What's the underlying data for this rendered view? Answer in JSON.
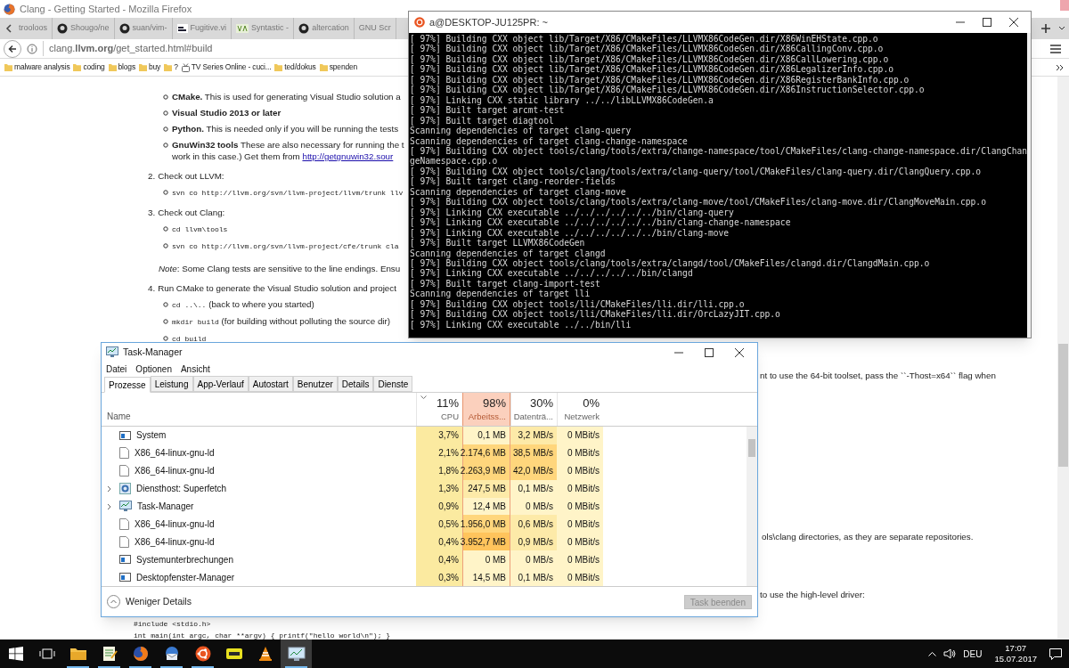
{
  "browser": {
    "title": "Clang - Getting Started - Mozilla Firefox",
    "tabs": [
      {
        "label": "trooloos",
        "kind": "plain",
        "selected": false
      },
      {
        "label": "Shougo/ne",
        "kind": "github",
        "selected": false
      },
      {
        "label": "suan/vim-",
        "kind": "github",
        "selected": false
      },
      {
        "label": "Fugitive.vi",
        "kind": "fugitive",
        "selected": false
      },
      {
        "label": "Syntastic -",
        "kind": "va",
        "selected": false
      },
      {
        "label": "altercation",
        "kind": "github",
        "selected": false
      },
      {
        "label": "GNU Scr",
        "kind": "plain",
        "selected": false
      }
    ],
    "url": "clang.**llvm.org**/get_started.html#build",
    "bookmarks": [
      {
        "label": "malware analysis",
        "kind": "folder"
      },
      {
        "label": "coding",
        "kind": "folder"
      },
      {
        "label": "blogs",
        "kind": "folder"
      },
      {
        "label": "buy",
        "kind": "folder"
      },
      {
        "label": "?",
        "kind": "folder"
      },
      {
        "label": "TV Series Online - cuci...",
        "kind": "site"
      },
      {
        "label": "ted/dokus",
        "kind": "folder"
      },
      {
        "label": "spenden",
        "kind": "folder"
      }
    ]
  },
  "page": {
    "blocks": [
      {
        "kind": "bullet",
        "parts": [
          {
            "kind": "text",
            "text": "**CMake.** This is used for generating Visual Studio solution a"
          }
        ]
      },
      {
        "kind": "bullet",
        "parts": [
          {
            "kind": "text",
            "text": "**Visual Studio 2013 or later**"
          }
        ]
      },
      {
        "kind": "bullet",
        "parts": [
          {
            "kind": "text",
            "text": "**Python.** This is needed only if you will be running the tests"
          }
        ]
      },
      {
        "kind": "bullet",
        "parts": [
          {
            "kind": "text",
            "text": "**GnuWin32 tools** These are also necessary for running the t"
          }
        ]
      },
      {
        "kind": "continuation",
        "parts": [
          {
            "kind": "text",
            "text": "work in this case.) Get them from "
          },
          {
            "kind": "link",
            "text": "http://getgnuwin32.sour"
          }
        ]
      },
      {
        "kind": "numbered",
        "number": "2.",
        "parts": [
          {
            "kind": "text",
            "text": "Check out LLVM:"
          }
        ]
      },
      {
        "kind": "bullet",
        "parts": [
          {
            "kind": "code",
            "text": "svn co http://llvm.org/svn/llvm-project/llvm/trunk llv"
          }
        ]
      },
      {
        "kind": "numbered",
        "number": "3.",
        "parts": [
          {
            "kind": "text",
            "text": "Check out Clang:"
          }
        ]
      },
      {
        "kind": "bullet",
        "parts": [
          {
            "kind": "code",
            "text": "cd llvm\\tools"
          }
        ]
      },
      {
        "kind": "bullet",
        "parts": [
          {
            "kind": "code",
            "text": "svn co http://llvm.org/svn/llvm-project/cfe/trunk cla"
          }
        ]
      },
      {
        "kind": "note",
        "parts": [
          {
            "kind": "text",
            "text": "*Note*: Some Clang tests are sensitive to the line endings. Ensu"
          }
        ]
      },
      {
        "kind": "numbered",
        "number": "4.",
        "parts": [
          {
            "kind": "text",
            "text": "Run CMake to generate the Visual Studio solution and project"
          }
        ]
      },
      {
        "kind": "bullet",
        "parts": [
          {
            "kind": "code",
            "text": "cd ..\\.."
          },
          {
            "kind": "text",
            "text": " (back to where you started)"
          }
        ]
      },
      {
        "kind": "bullet",
        "parts": [
          {
            "kind": "code",
            "text": "mkdir build"
          },
          {
            "kind": "text",
            "text": " (for building without polluting the source dir)"
          }
        ]
      },
      {
        "kind": "bullet",
        "parts": [
          {
            "kind": "code",
            "text": "cd build"
          }
        ]
      }
    ],
    "fragments": [
      "nt to use the 64-bit toolset, pass the ``-Thost=x64`` flag when",
      "ols\\clang directories, as they are separate repositories.",
      "to use the high-level driver:"
    ],
    "code": [
      "#include <stdio.h>",
      "int main(int argc, char **argv) { printf(\"hello world\\n\"); }"
    ]
  },
  "terminal": {
    "title": "a@DESKTOP-JU125PR: ~",
    "lines": [
      "[ 97%] Building CXX object lib/Target/X86/CMakeFiles/LLVMX86CodeGen.dir/X86WinEHState.cpp.o",
      "[ 97%] Building CXX object lib/Target/X86/CMakeFiles/LLVMX86CodeGen.dir/X86CallingConv.cpp.o",
      "[ 97%] Building CXX object lib/Target/X86/CMakeFiles/LLVMX86CodeGen.dir/X86CallLowering.cpp.o",
      "[ 97%] Building CXX object lib/Target/X86/CMakeFiles/LLVMX86CodeGen.dir/X86LegalizerInfo.cpp.o",
      "[ 97%] Building CXX object lib/Target/X86/CMakeFiles/LLVMX86CodeGen.dir/X86RegisterBankInfo.cpp.o",
      "[ 97%] Building CXX object lib/Target/X86/CMakeFiles/LLVMX86CodeGen.dir/X86InstructionSelector.cpp.o",
      "[ 97%] Linking CXX static library ../../libLLVMX86CodeGen.a",
      "[ 97%] Built target arcmt-test",
      "[ 97%] Built target diagtool",
      "Scanning dependencies of target clang-query",
      "Scanning dependencies of target clang-change-namespace",
      "[ 97%] Building CXX object tools/clang/tools/extra/change-namespace/tool/CMakeFiles/clang-change-namespace.dir/ClangChan",
      "geNamespace.cpp.o",
      "[ 97%] Building CXX object tools/clang/tools/extra/clang-query/tool/CMakeFiles/clang-query.dir/ClangQuery.cpp.o",
      "[ 97%] Built target clang-reorder-fields",
      "Scanning dependencies of target clang-move",
      "[ 97%] Building CXX object tools/clang/tools/extra/clang-move/tool/CMakeFiles/clang-move.dir/ClangMoveMain.cpp.o",
      "[ 97%] Linking CXX executable ../../../../../../bin/clang-query",
      "[ 97%] Linking CXX executable ../../../../../../bin/clang-change-namespace",
      "[ 97%] Linking CXX executable ../../../../../../bin/clang-move",
      "[ 97%] Built target LLVMX86CodeGen",
      "Scanning dependencies of target clangd",
      "[ 97%] Building CXX object tools/clang/tools/extra/clangd/tool/CMakeFiles/clangd.dir/ClangdMain.cpp.o",
      "[ 97%] Linking CXX executable ../../../../../bin/clangd",
      "[ 97%] Built target clang-import-test",
      "Scanning dependencies of target lli",
      "[ 97%] Building CXX object tools/lli/CMakeFiles/lli.dir/lli.cpp.o",
      "[ 97%] Building CXX object tools/lli/CMakeFiles/lli.dir/OrcLazyJIT.cpp.o",
      "[ 97%] Linking CXX executable ../../bin/lli"
    ]
  },
  "task_manager": {
    "title": "Task-Manager",
    "menu": [
      "Datei",
      "Optionen",
      "Ansicht"
    ],
    "tabs": [
      {
        "label": "Prozesse",
        "selected": true
      },
      {
        "label": "Leistung",
        "selected": false
      },
      {
        "label": "App-Verlauf",
        "selected": false
      },
      {
        "label": "Autostart",
        "selected": false
      },
      {
        "label": "Benutzer",
        "selected": false
      },
      {
        "label": "Details",
        "selected": false
      },
      {
        "label": "Dienste",
        "selected": false
      }
    ],
    "name_header": "Name",
    "columns": [
      {
        "percent": "11%",
        "label": "CPU",
        "sorted": true,
        "alert": false
      },
      {
        "percent": "98%",
        "label": "Arbeitss...",
        "sorted": false,
        "alert": true
      },
      {
        "percent": "30%",
        "label": "Datenträ...",
        "sorted": false,
        "alert": false
      },
      {
        "percent": "0%",
        "label": "Netzwerk",
        "sorted": false,
        "alert": false
      }
    ],
    "rows": [
      {
        "name": "System",
        "kind": "system",
        "expandable": false,
        "cells": [
          {
            "text": "3,7%",
            "color": "#fbeaa0"
          },
          {
            "text": "0,1 MB",
            "color": "#fff4c8"
          },
          {
            "text": "3,2 MB/s",
            "color": "#fdeaa8"
          },
          {
            "text": "0 MBit/s",
            "color": "#fff4c8"
          }
        ]
      },
      {
        "name": "X86_64-linux-gnu-ld",
        "kind": "file",
        "expandable": false,
        "cells": [
          {
            "text": "2,1%",
            "color": "#fbeaa0"
          },
          {
            "text": "2.174,6 MB",
            "color": "#ffd67c"
          },
          {
            "text": "38,5 MB/s",
            "color": "#ffd67c"
          },
          {
            "text": "0 MBit/s",
            "color": "#fff4c8"
          }
        ]
      },
      {
        "name": "X86_64-linux-gnu-ld",
        "kind": "file",
        "expandable": false,
        "cells": [
          {
            "text": "1,8%",
            "color": "#fbeaa0"
          },
          {
            "text": "2.263,9 MB",
            "color": "#ffd67c"
          },
          {
            "text": "42,0 MB/s",
            "color": "#ffd67c"
          },
          {
            "text": "0 MBit/s",
            "color": "#fff4c8"
          }
        ]
      },
      {
        "name": "Diensthost: Superfetch",
        "kind": "service",
        "expandable": true,
        "cells": [
          {
            "text": "1,3%",
            "color": "#fbeaa0"
          },
          {
            "text": "247,5 MB",
            "color": "#fdeaa8"
          },
          {
            "text": "0,1 MB/s",
            "color": "#fff4c8"
          },
          {
            "text": "0 MBit/s",
            "color": "#fff4c8"
          }
        ]
      },
      {
        "name": "Task-Manager",
        "kind": "taskmgr",
        "expandable": true,
        "cells": [
          {
            "text": "0,9%",
            "color": "#fbeaa0"
          },
          {
            "text": "12,4 MB",
            "color": "#fff4c8"
          },
          {
            "text": "0 MB/s",
            "color": "#fff4c8"
          },
          {
            "text": "0 MBit/s",
            "color": "#fff4c8"
          }
        ]
      },
      {
        "name": "X86_64-linux-gnu-ld",
        "kind": "file",
        "expandable": false,
        "cells": [
          {
            "text": "0,5%",
            "color": "#fbeaa0"
          },
          {
            "text": "1.956,0 MB",
            "color": "#ffd67c"
          },
          {
            "text": "0,6 MB/s",
            "color": "#fdeaa8"
          },
          {
            "text": "0 MBit/s",
            "color": "#fff4c8"
          }
        ]
      },
      {
        "name": "X86_64-linux-gnu-ld",
        "kind": "file",
        "expandable": false,
        "cells": [
          {
            "text": "0,4%",
            "color": "#fbeaa0"
          },
          {
            "text": "3.952,7 MB",
            "color": "#ffc45c"
          },
          {
            "text": "0,9 MB/s",
            "color": "#fdeaa8"
          },
          {
            "text": "0 MBit/s",
            "color": "#fff4c8"
          }
        ]
      },
      {
        "name": "Systemunterbrechungen",
        "kind": "system",
        "expandable": false,
        "cells": [
          {
            "text": "0,4%",
            "color": "#fbeaa0"
          },
          {
            "text": "0 MB",
            "color": "#fff4c8"
          },
          {
            "text": "0 MB/s",
            "color": "#fff4c8"
          },
          {
            "text": "0 MBit/s",
            "color": "#fff4c8"
          }
        ]
      },
      {
        "name": "Desktopfenster-Manager",
        "kind": "system",
        "expandable": false,
        "cells": [
          {
            "text": "0,3%",
            "color": "#fbeaa0"
          },
          {
            "text": "14,5 MB",
            "color": "#fff4c8"
          },
          {
            "text": "0,1 MB/s",
            "color": "#fff4c8"
          },
          {
            "text": "0 MBit/s",
            "color": "#fff4c8"
          }
        ]
      }
    ],
    "fewer_details": "Weniger Details",
    "end_task": {
      "label": "Task beenden",
      "disabled": true
    }
  },
  "taskbar": {
    "items": [
      {
        "kind": "start",
        "running": false,
        "selected": false
      },
      {
        "kind": "taskview",
        "running": false,
        "selected": false
      },
      {
        "kind": "folder",
        "running": true,
        "selected": false
      },
      {
        "kind": "notepad",
        "running": true,
        "selected": false
      },
      {
        "kind": "firefox",
        "running": true,
        "selected": false
      },
      {
        "kind": "mail",
        "running": true,
        "selected": false
      },
      {
        "kind": "ubuntu",
        "running": true,
        "selected": false
      },
      {
        "kind": "app",
        "running": false,
        "selected": false
      },
      {
        "kind": "vlc",
        "running": false,
        "selected": false
      },
      {
        "kind": "taskmgr",
        "running": true,
        "selected": true
      }
    ],
    "language": "DEU",
    "time": "17:07",
    "date": "15.07.2017"
  }
}
